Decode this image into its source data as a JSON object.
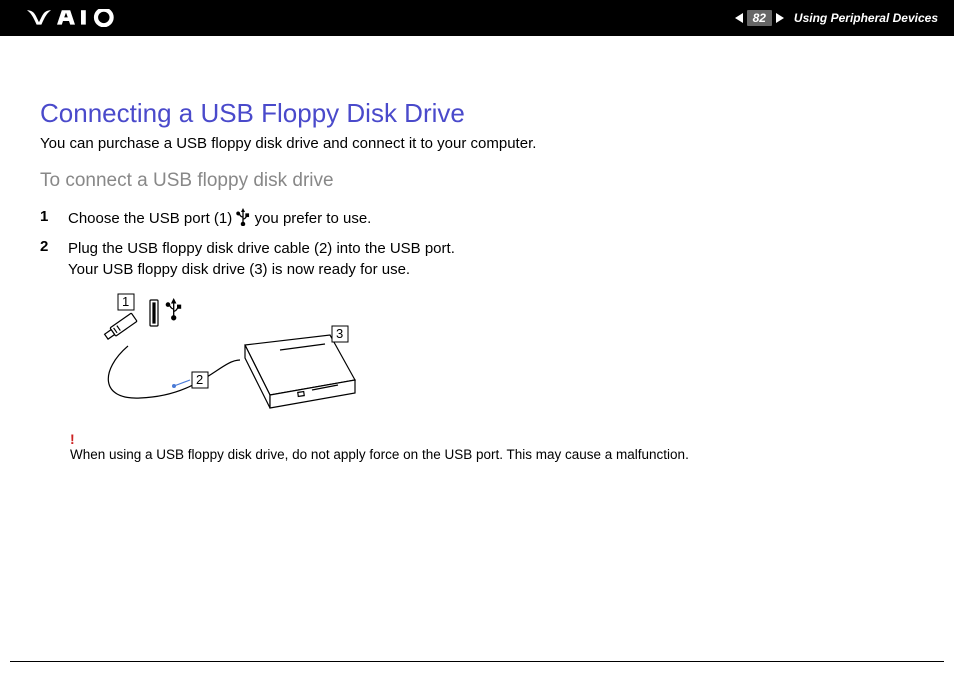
{
  "header": {
    "page_number": "82",
    "section": "Using Peripheral Devices"
  },
  "title": "Connecting a USB Floppy Disk Drive",
  "intro": "You can purchase a USB floppy disk drive and connect it to your computer.",
  "subtitle": "To connect a USB floppy disk drive",
  "steps": [
    {
      "num": "1",
      "text_before": "Choose the USB port (1) ",
      "text_after": " you prefer to use."
    },
    {
      "num": "2",
      "line1": "Plug the USB floppy disk drive cable (2) into the USB port.",
      "line2": "Your USB floppy disk drive (3) is now ready for use."
    }
  ],
  "diagram": {
    "callouts": [
      "1",
      "2",
      "3"
    ]
  },
  "warning": {
    "mark": "!",
    "text": "When using a USB floppy disk drive, do not apply force on the USB port. This may cause a malfunction."
  }
}
